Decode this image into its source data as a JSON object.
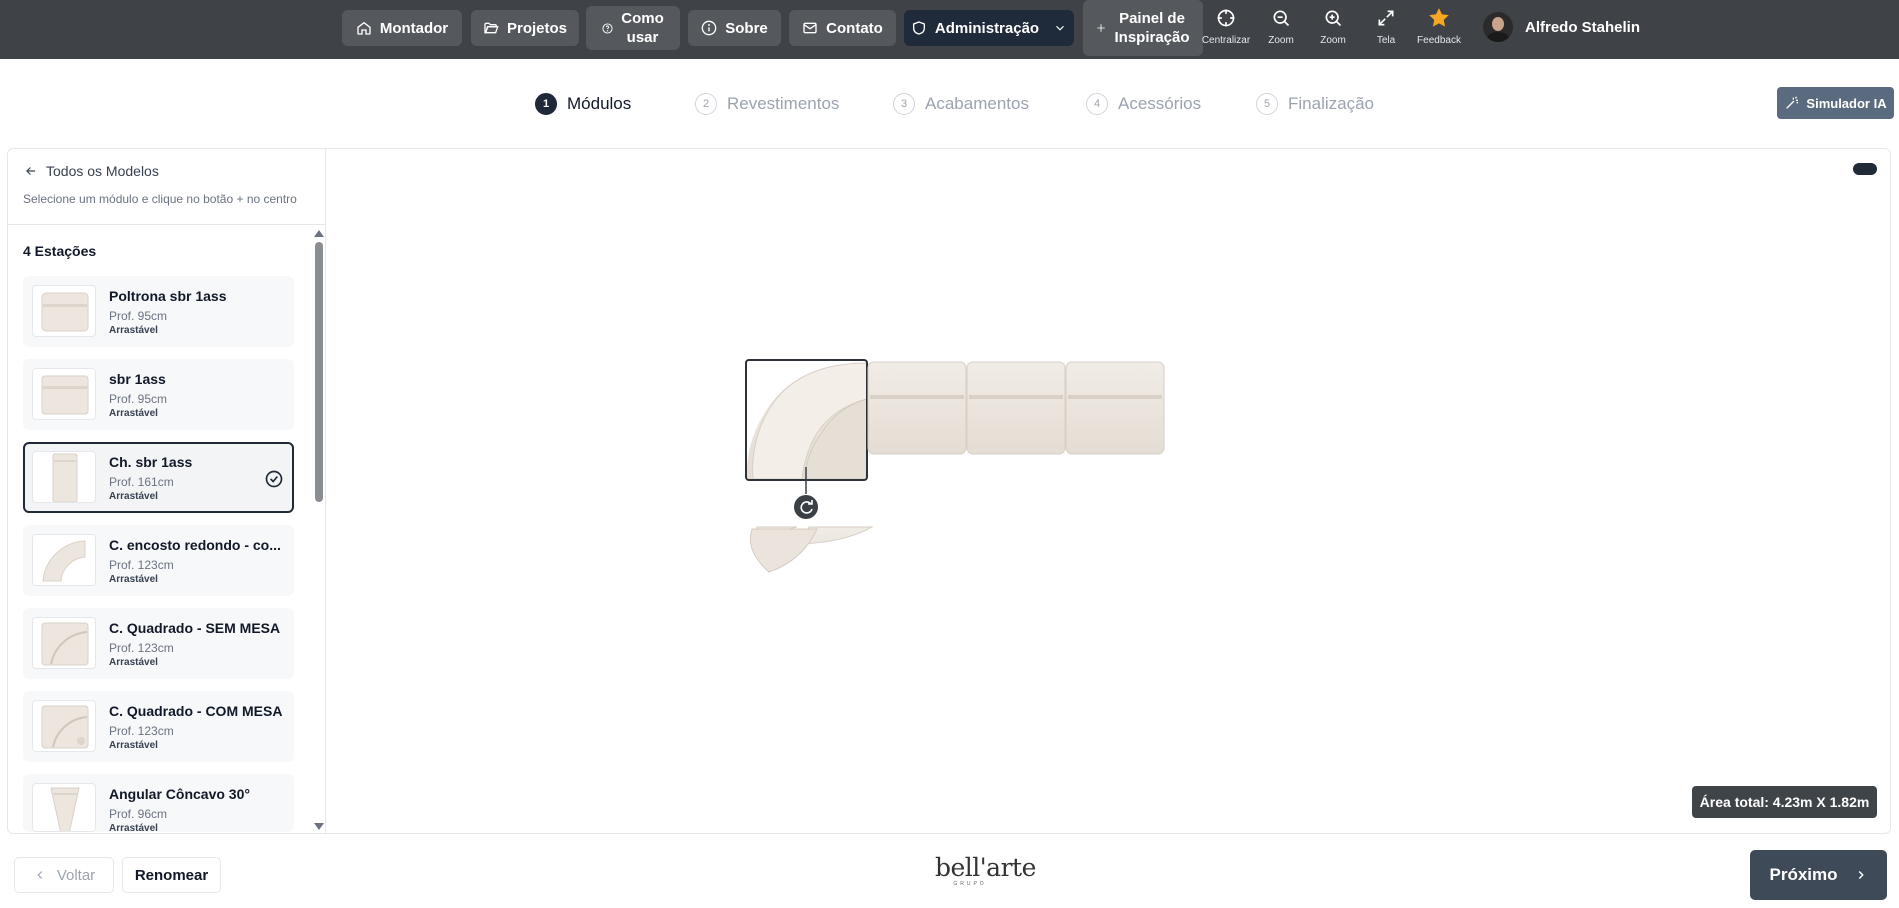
{
  "nav": {
    "montador": "Montador",
    "projetos": "Projetos",
    "como_usar_1": "Como",
    "como_usar_2": "usar",
    "sobre": "Sobre",
    "contato": "Contato",
    "administracao": "Administração",
    "painel_1": "Painel de",
    "painel_2": "Inspiração"
  },
  "tools": {
    "centralizar": "Centralizar",
    "zoom_out": "Zoom",
    "zoom_in": "Zoom",
    "tela": "Tela",
    "feedback": "Feedback"
  },
  "user": {
    "name": "Alfredo Stahelin"
  },
  "steps": [
    {
      "num": "1",
      "label": "Módulos"
    },
    {
      "num": "2",
      "label": "Revestimentos"
    },
    {
      "num": "3",
      "label": "Acabamentos"
    },
    {
      "num": "4",
      "label": "Acessórios"
    },
    {
      "num": "5",
      "label": "Finalização"
    }
  ],
  "simulator": {
    "label": "Simulador IA"
  },
  "sidebar": {
    "back_label": "Todos os Modelos",
    "hint": "Selecione um módulo e clique no botão + no centro",
    "section_title": "4 Estações",
    "items": [
      {
        "name": "Poltrona sbr 1ass",
        "prof": "Prof. 95cm",
        "tag": "Arrastável"
      },
      {
        "name": "sbr 1ass",
        "prof": "Prof. 95cm",
        "tag": "Arrastável"
      },
      {
        "name": "Ch. sbr 1ass",
        "prof": "Prof. 161cm",
        "tag": "Arrastável"
      },
      {
        "name": "C. encosto redondo - co...",
        "prof": "Prof. 123cm",
        "tag": "Arrastável"
      },
      {
        "name": "C. Quadrado - SEM MESA",
        "prof": "Prof. 123cm",
        "tag": "Arrastável"
      },
      {
        "name": "C. Quadrado - COM MESA",
        "prof": "Prof. 123cm",
        "tag": "Arrastável"
      },
      {
        "name": "Angular Côncavo 30°",
        "prof": "Prof. 96cm",
        "tag": "Arrastável"
      }
    ]
  },
  "canvas": {
    "area_total": "Área total: 4.23m X 1.82m"
  },
  "footer": {
    "back": "Voltar",
    "rename": "Renomear",
    "logo_word": "bell'arte",
    "logo_sub": "GRUPO",
    "next": "Próximo"
  },
  "colors": {
    "topbar": "#3f4347",
    "accent_dark": "#1f2937",
    "feedback_star": "#f5a623",
    "sofa_fabric": "#ece6df"
  }
}
